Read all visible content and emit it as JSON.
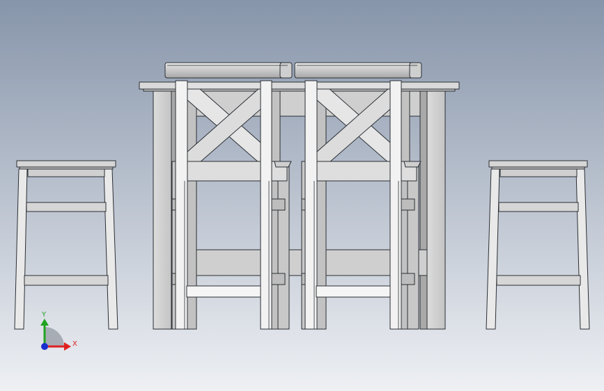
{
  "viewport": {
    "background_top": "#8795aa",
    "background_bottom": "#eef0f4"
  },
  "colors": {
    "face_light": "#f4f4f4",
    "face_mid": "#d9d9d9",
    "face_dark": "#b9b9b9",
    "face_shadow": "#9a9a9a",
    "edge": "#2a2e33"
  },
  "triad": {
    "x_label": "X",
    "y_label": "Y",
    "x_color": "#e02020",
    "y_color": "#1fa31f",
    "z_color": "#1a2fd0"
  }
}
